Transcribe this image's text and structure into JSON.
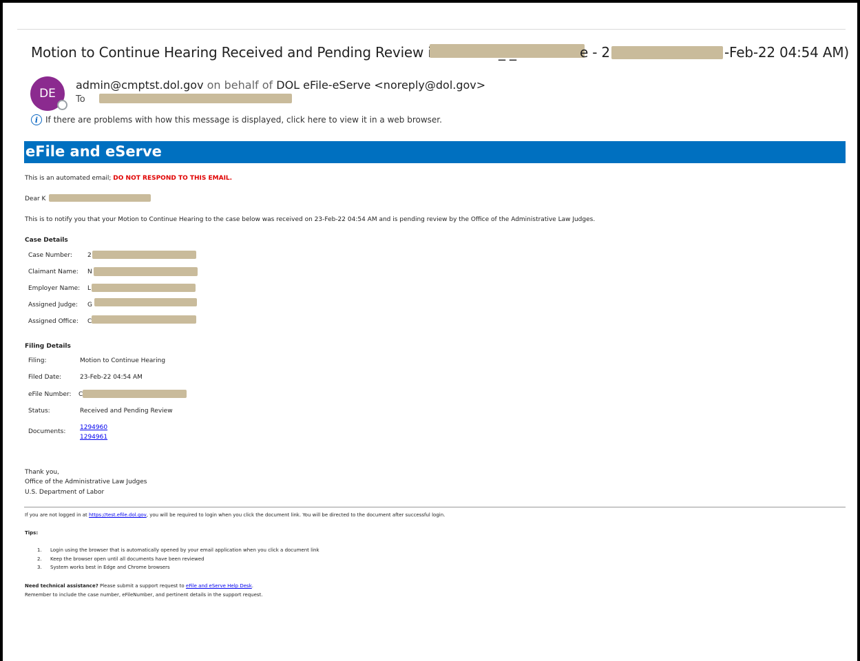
{
  "email": {
    "subject_start": "Motion to Continue Hearing Received and Pending Review in",
    "subject_mid1": "_ _",
    "subject_mid2": "e - 2",
    "subject_end": "-Feb-22 04:54 AM)",
    "avatar_initials": "DE",
    "sender_email": "admin@cmptst.dol.gov",
    "sender_behalf": "on behalf of",
    "sender_name": "DOL eFile-eServe <noreply@dol.gov>",
    "to_label": "To",
    "display_notice": "If there are problems with how this message is displayed, click here to view it in a web browser."
  },
  "banner": {
    "title": "eFile and eServe"
  },
  "body": {
    "automated_prefix": "This is an automated email;",
    "automated_warning": "DO NOT RESPOND TO THIS EMAIL.",
    "greeting": "Dear K",
    "notification": "This is to notify you that your Motion to Continue Hearing to the case below was received on 23-Feb-22 04:54 AM and is pending review by the Office of the Administrative Law Judges.",
    "case_details_heading": "Case Details",
    "case_details": [
      {
        "label": "Case Number:",
        "value": "2"
      },
      {
        "label": "Claimant Name:",
        "value": "N"
      },
      {
        "label": "Employer Name:",
        "value": "L"
      },
      {
        "label": "Assigned Judge:",
        "value": "G"
      },
      {
        "label": "Assigned Office:",
        "value": "C"
      }
    ],
    "filing_details_heading": "Filing Details",
    "filing_details": [
      {
        "label": "Filing:",
        "value": "Motion to Continue Hearing"
      },
      {
        "label": "Filed Date:",
        "value": "23-Feb-22 04:54 AM"
      },
      {
        "label": "eFile Number:",
        "value": "C"
      },
      {
        "label": "Status:",
        "value": "Received and Pending Review"
      },
      {
        "label": "Documents:",
        "value": ""
      }
    ],
    "documents": [
      "1294960",
      "1294961"
    ],
    "signoff": [
      "Thank you,",
      "Office of the Administrative Law Judges",
      "U.S. Department of Labor"
    ]
  },
  "footer": {
    "login_prefix": "If you are not logged in at",
    "login_link": "https://test.efile.dol.gov",
    "login_suffix": ", you will be required to login when you click the document link. You will be directed to the document after successful login.",
    "tips_heading": "Tips:",
    "tips": [
      "Login using the browser that is automatically opened by your email application when you click a document link",
      "Keep the browser open until all documents have been reviewed",
      "System works best in Edge and Chrome browsers"
    ],
    "assist_heading": "Need technical assistance?",
    "assist_text": "Please submit a support request to",
    "assist_link": "eFile and eServe Help Desk",
    "assist_end": ".",
    "remember": "Remember to include the case number, eFileNumber, and pertinent details in the support request."
  },
  "colors": {
    "banner": "#0070c0",
    "avatar": "#8b2a8f",
    "warning": "#e00000",
    "link": "#0000ee",
    "redaction": "#c9bb9b"
  }
}
